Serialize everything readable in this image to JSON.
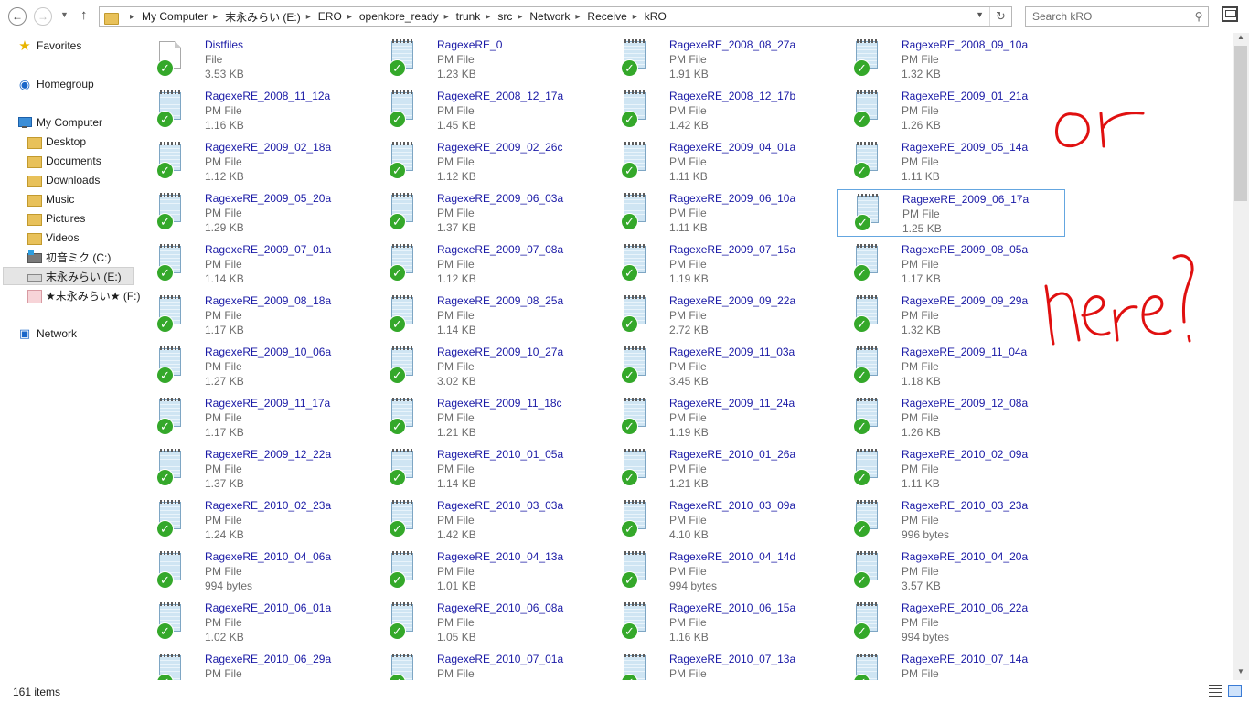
{
  "toolbar": {
    "back_icon": "back-arrow-icon",
    "forward_icon": "forward-arrow-icon",
    "up_icon": "up-arrow-icon"
  },
  "address": {
    "crumbs": [
      "My Computer",
      "末永みらい (E:)",
      "ERO",
      "openkore_ready",
      "trunk",
      "src",
      "Network",
      "Receive",
      "kRO"
    ]
  },
  "search": {
    "placeholder": "Search kRO"
  },
  "nav": {
    "favorites": "Favorites",
    "homegroup": "Homegroup",
    "my_computer": "My Computer",
    "desktop": "Desktop",
    "documents": "Documents",
    "downloads": "Downloads",
    "music": "Music",
    "pictures": "Pictures",
    "videos": "Videos",
    "drive_c": "初音ミク (C:)",
    "drive_e": "末永みらい (E:)",
    "drive_f": "★末永みらい★ (F:)",
    "network": "Network"
  },
  "files": [
    {
      "name": "Distfiles",
      "type": "File",
      "size": "3.53 KB",
      "kind": "plain"
    },
    {
      "name": "RagexeRE_0",
      "type": "PM File",
      "size": "1.23 KB"
    },
    {
      "name": "RagexeRE_2008_08_27a",
      "type": "PM File",
      "size": "1.91 KB"
    },
    {
      "name": "RagexeRE_2008_09_10a",
      "type": "PM File",
      "size": "1.32 KB"
    },
    {
      "name": "RagexeRE_2008_11_12a",
      "type": "PM File",
      "size": "1.16 KB"
    },
    {
      "name": "RagexeRE_2008_12_17a",
      "type": "PM File",
      "size": "1.45 KB"
    },
    {
      "name": "RagexeRE_2008_12_17b",
      "type": "PM File",
      "size": "1.42 KB"
    },
    {
      "name": "RagexeRE_2009_01_21a",
      "type": "PM File",
      "size": "1.26 KB"
    },
    {
      "name": "RagexeRE_2009_02_18a",
      "type": "PM File",
      "size": "1.12 KB"
    },
    {
      "name": "RagexeRE_2009_02_26c",
      "type": "PM File",
      "size": "1.12 KB"
    },
    {
      "name": "RagexeRE_2009_04_01a",
      "type": "PM File",
      "size": "1.11 KB"
    },
    {
      "name": "RagexeRE_2009_05_14a",
      "type": "PM File",
      "size": "1.11 KB"
    },
    {
      "name": "RagexeRE_2009_05_20a",
      "type": "PM File",
      "size": "1.29 KB"
    },
    {
      "name": "RagexeRE_2009_06_03a",
      "type": "PM File",
      "size": "1.37 KB"
    },
    {
      "name": "RagexeRE_2009_06_10a",
      "type": "PM File",
      "size": "1.11 KB"
    },
    {
      "name": "RagexeRE_2009_06_17a",
      "type": "PM File",
      "size": "1.25 KB",
      "selected": true
    },
    {
      "name": "RagexeRE_2009_07_01a",
      "type": "PM File",
      "size": "1.14 KB"
    },
    {
      "name": "RagexeRE_2009_07_08a",
      "type": "PM File",
      "size": "1.12 KB"
    },
    {
      "name": "RagexeRE_2009_07_15a",
      "type": "PM File",
      "size": "1.19 KB"
    },
    {
      "name": "RagexeRE_2009_08_05a",
      "type": "PM File",
      "size": "1.17 KB"
    },
    {
      "name": "RagexeRE_2009_08_18a",
      "type": "PM File",
      "size": "1.17 KB"
    },
    {
      "name": "RagexeRE_2009_08_25a",
      "type": "PM File",
      "size": "1.14 KB"
    },
    {
      "name": "RagexeRE_2009_09_22a",
      "type": "PM File",
      "size": "2.72 KB"
    },
    {
      "name": "RagexeRE_2009_09_29a",
      "type": "PM File",
      "size": "1.32 KB"
    },
    {
      "name": "RagexeRE_2009_10_06a",
      "type": "PM File",
      "size": "1.27 KB"
    },
    {
      "name": "RagexeRE_2009_10_27a",
      "type": "PM File",
      "size": "3.02 KB"
    },
    {
      "name": "RagexeRE_2009_11_03a",
      "type": "PM File",
      "size": "3.45 KB"
    },
    {
      "name": "RagexeRE_2009_11_04a",
      "type": "PM File",
      "size": "1.18 KB"
    },
    {
      "name": "RagexeRE_2009_11_17a",
      "type": "PM File",
      "size": "1.17 KB"
    },
    {
      "name": "RagexeRE_2009_11_18c",
      "type": "PM File",
      "size": "1.21 KB"
    },
    {
      "name": "RagexeRE_2009_11_24a",
      "type": "PM File",
      "size": "1.19 KB"
    },
    {
      "name": "RagexeRE_2009_12_08a",
      "type": "PM File",
      "size": "1.26 KB"
    },
    {
      "name": "RagexeRE_2009_12_22a",
      "type": "PM File",
      "size": "1.37 KB"
    },
    {
      "name": "RagexeRE_2010_01_05a",
      "type": "PM File",
      "size": "1.14 KB"
    },
    {
      "name": "RagexeRE_2010_01_26a",
      "type": "PM File",
      "size": "1.21 KB"
    },
    {
      "name": "RagexeRE_2010_02_09a",
      "type": "PM File",
      "size": "1.11 KB"
    },
    {
      "name": "RagexeRE_2010_02_23a",
      "type": "PM File",
      "size": "1.24 KB"
    },
    {
      "name": "RagexeRE_2010_03_03a",
      "type": "PM File",
      "size": "1.42 KB"
    },
    {
      "name": "RagexeRE_2010_03_09a",
      "type": "PM File",
      "size": "4.10 KB"
    },
    {
      "name": "RagexeRE_2010_03_23a",
      "type": "PM File",
      "size": "996 bytes"
    },
    {
      "name": "RagexeRE_2010_04_06a",
      "type": "PM File",
      "size": "994 bytes"
    },
    {
      "name": "RagexeRE_2010_04_13a",
      "type": "PM File",
      "size": "1.01 KB"
    },
    {
      "name": "RagexeRE_2010_04_14d",
      "type": "PM File",
      "size": "994 bytes"
    },
    {
      "name": "RagexeRE_2010_04_20a",
      "type": "PM File",
      "size": "3.57 KB"
    },
    {
      "name": "RagexeRE_2010_06_01a",
      "type": "PM File",
      "size": "1.02 KB"
    },
    {
      "name": "RagexeRE_2010_06_08a",
      "type": "PM File",
      "size": "1.05 KB"
    },
    {
      "name": "RagexeRE_2010_06_15a",
      "type": "PM File",
      "size": "1.16 KB"
    },
    {
      "name": "RagexeRE_2010_06_22a",
      "type": "PM File",
      "size": "994 bytes"
    },
    {
      "name": "RagexeRE_2010_06_29a",
      "type": "PM File",
      "size": ""
    },
    {
      "name": "RagexeRE_2010_07_01a",
      "type": "PM File",
      "size": ""
    },
    {
      "name": "RagexeRE_2010_07_13a",
      "type": "PM File",
      "size": ""
    },
    {
      "name": "RagexeRE_2010_07_14a",
      "type": "PM File",
      "size": ""
    }
  ],
  "status": {
    "item_count": "161 items"
  },
  "annotations": {
    "color": "#e01010",
    "word_1": "or",
    "word_2": "here?"
  },
  "colors": {
    "link_blue": "#1a1aa6",
    "selection_border": "#64a6e0",
    "sync_check_green": "#34a82a"
  }
}
